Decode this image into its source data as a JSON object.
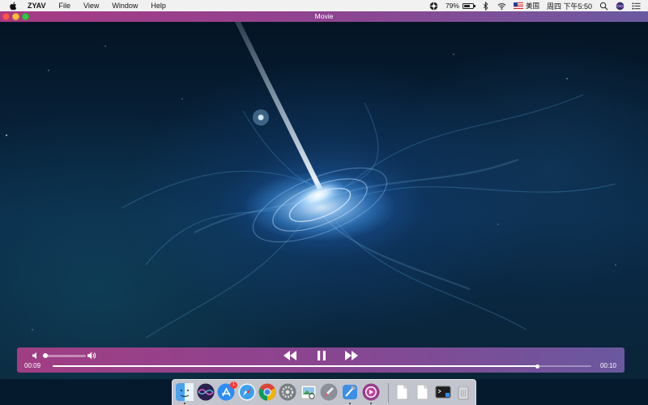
{
  "menubar": {
    "app_name": "ZYAV",
    "menus": [
      "File",
      "View",
      "Window",
      "Help"
    ],
    "battery_percent": "79%",
    "battery_level": 0.79,
    "input_language": "美国",
    "clock": "周四 下午5:50"
  },
  "window": {
    "title": "Movie"
  },
  "player": {
    "current_time": "00:09",
    "duration": "00:10",
    "progress": 0.9,
    "volume": 0.04
  },
  "dock": {
    "apps": [
      "finder-icon",
      "siri-icon",
      "app-store-icon",
      "safari-icon",
      "chrome-icon",
      "system-preferences-icon",
      "preview-icon",
      "launchpad-icon",
      "xcode-icon",
      "zyav-icon"
    ],
    "appstore_badge": "1",
    "right_items": [
      "document-icon",
      "document-icon",
      "terminal-icon",
      "trash-icon"
    ]
  },
  "colors": {
    "bar_start": "#a13d83",
    "bar_mid": "#8a4590",
    "bar_end": "#6a58a0"
  }
}
